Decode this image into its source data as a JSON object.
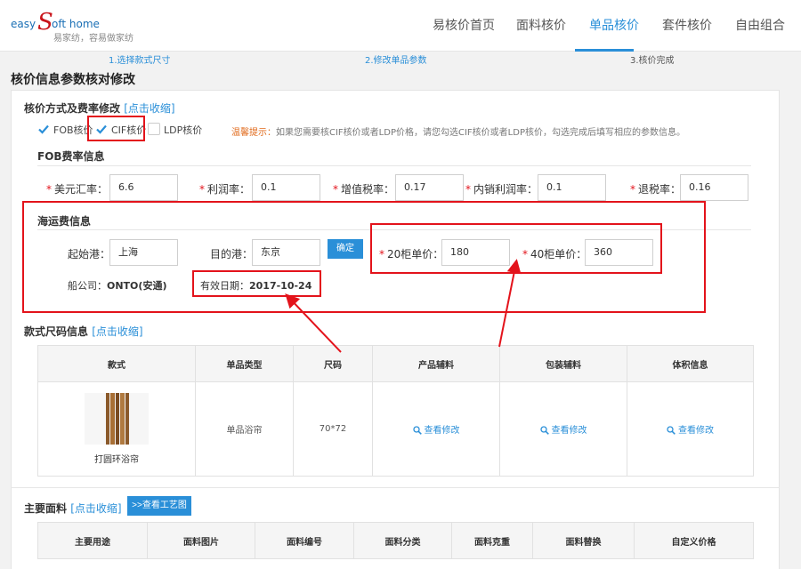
{
  "logo": {
    "easy": "easy",
    "s": "S",
    "rest": "oft home",
    "slogan": "易家纺，容易做家纺"
  },
  "nav": {
    "items": [
      "易核价首页",
      "面料核价",
      "单品核价",
      "套件核价",
      "自由组合"
    ]
  },
  "steps": [
    "1.选择款式尺寸",
    "2.修改单品参数",
    "3.核价完成"
  ],
  "page_title": "核价信息参数核对修改",
  "pricing": {
    "title": "核价方式及费率修改",
    "collapse_link": "[点击收缩]",
    "options": [
      {
        "label": "FOB核价",
        "checked": true
      },
      {
        "label": "CIF核价",
        "checked": true
      },
      {
        "label": "LDP核价",
        "checked": false
      }
    ],
    "tip_label": "温馨提示：",
    "tip_text": "如果您需要核CIF核价或者LDP价格，请您勾选CIF核价或者LDP核价，勾选完成后填写相应的参数信息。"
  },
  "fob": {
    "title": "FOB费率信息",
    "required_mark": "*",
    "fields": [
      {
        "label": "美元汇率：",
        "value": "6.6"
      },
      {
        "label": "利润率：",
        "value": "0.1"
      },
      {
        "label": "增值税率：",
        "value": "0.17"
      },
      {
        "label": "内销利润率：",
        "value": "0.1"
      },
      {
        "label": "退税率：",
        "value": "0.16"
      }
    ]
  },
  "shipping": {
    "title": "海运费信息",
    "origin_label": "起始港：",
    "origin_value": "上海",
    "dest_label": "目的港：",
    "dest_value": "东京",
    "confirm_label": "确定",
    "price20_label": "20柜单价：",
    "price20_value": "180",
    "price40_label": "40柜单价：",
    "price40_value": "360",
    "company_label": "船公司：",
    "company_value": "ONTO(安通)",
    "valid_label": "有效日期：",
    "valid_value": "2017-10-24"
  },
  "size_section": {
    "title": "款式尺码信息",
    "collapse_link": "[点击收缩]",
    "headers": [
      "款式",
      "单品类型",
      "尺码",
      "产品辅料",
      "包装辅料",
      "体积信息"
    ],
    "row": {
      "style_name": "打圆环浴帘",
      "type": "单品浴帘",
      "size": "70*72",
      "view_label": "查看修改"
    }
  },
  "fabric_section": {
    "title": "主要面料",
    "collapse_link": "[点击收缩]",
    "craft_button": ">>查看工艺图",
    "headers": [
      "主要用途",
      "面料图片",
      "面料编号",
      "面料分类",
      "面料克重",
      "面料替换",
      "自定义价格"
    ]
  },
  "colors": {
    "accent": "#2a8fd8",
    "highlight": "#e3131b"
  }
}
